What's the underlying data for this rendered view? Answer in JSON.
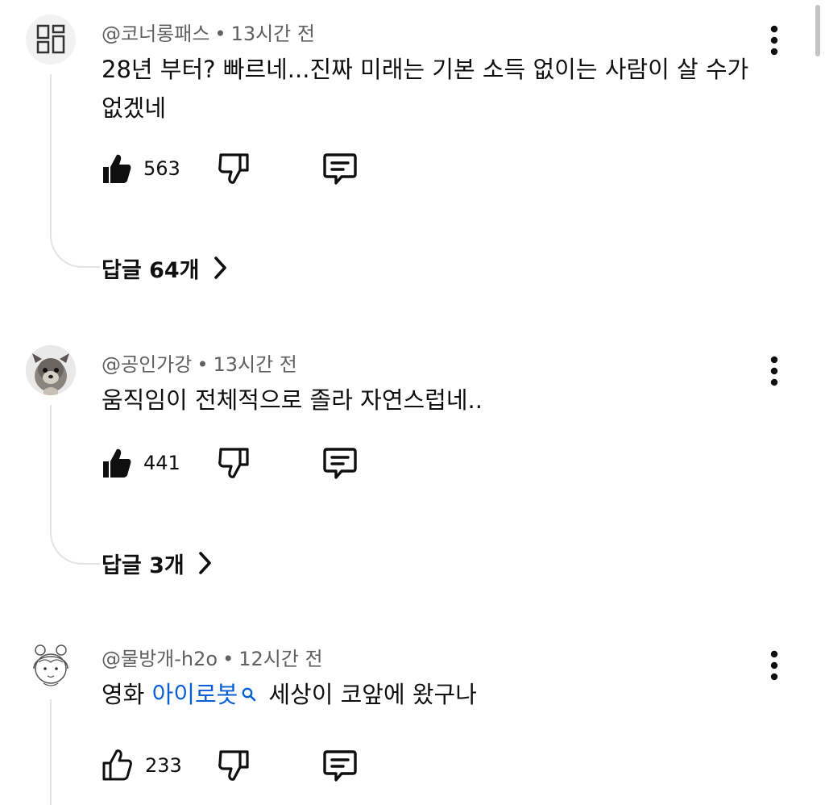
{
  "comments": [
    {
      "author": "@코너롱패스",
      "time": "13시간 전",
      "text": "28년 부터? 빠르네...진짜 미래는 기본 소득 없이는 사람이 살 수가 없겠네",
      "likes": "563",
      "replies": "답글 64개",
      "avatar": "square-grid-avatar",
      "liked": true
    },
    {
      "author": "@공인가강",
      "time": "13시간 전",
      "text": "움직임이 전체적으로 졸라 자연스럽네..",
      "likes": "441",
      "replies": "답글 3개",
      "avatar": "puppy-photo-avatar",
      "liked": true
    },
    {
      "author": "@물방개-h2o",
      "time": "12시간 전",
      "text_before": "영화 ",
      "text_link": "아이로봇",
      "text_after": "세상이 코앞에 왔구나",
      "likes": "233",
      "avatar": "sketch-girl-avatar",
      "liked": false
    }
  ],
  "separator": "•",
  "colors": {
    "text": "#0f0f0f",
    "secondary": "#606060",
    "link": "#065fd4",
    "thread": "#e4e4e4"
  },
  "icons": [
    "thumbs-up-icon",
    "thumbs-down-icon",
    "reply-icon",
    "chevron-right-icon",
    "more-vert-icon",
    "search-icon"
  ]
}
